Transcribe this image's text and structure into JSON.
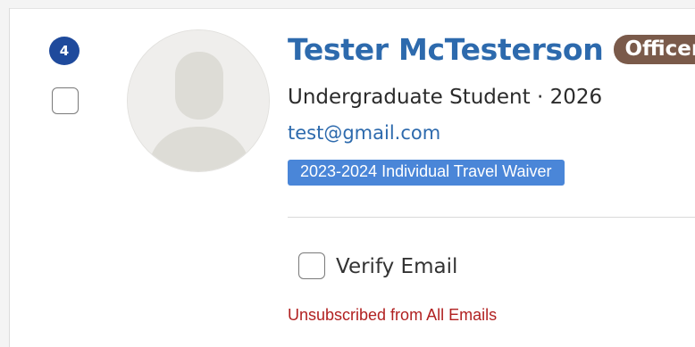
{
  "member": {
    "count": "4",
    "name": "Tester McTesterson",
    "role": "Officer",
    "subtitle": "Undergraduate Student · 2026",
    "email": "test@gmail.com",
    "tag": "2023-2024 Individual Travel Waiver",
    "verify_label": "Verify Email",
    "status": "Unsubscribed from All Emails"
  },
  "icons": {
    "avatar": "person-silhouette-icon"
  },
  "colors": {
    "link_blue": "#2d6aad",
    "badge_navy": "#1f4a9c",
    "officer_brown": "#7a5a4a",
    "tag_blue": "#4a86d8",
    "warning_red": "#b12121"
  }
}
